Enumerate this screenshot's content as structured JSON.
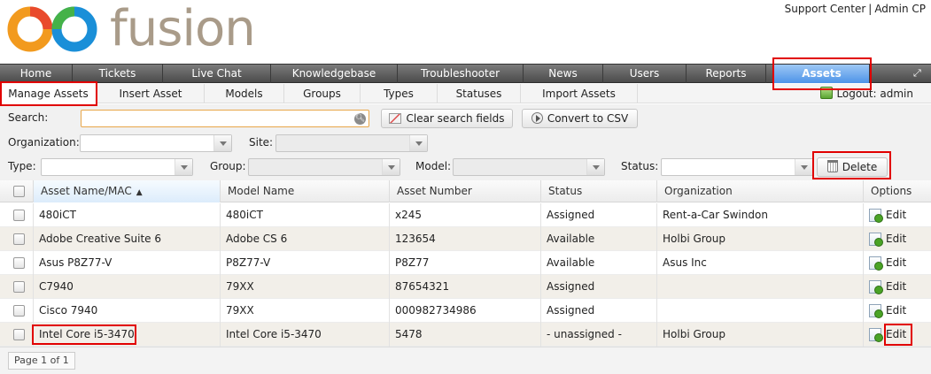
{
  "header": {
    "logo_text": "fusion",
    "support_link": "Support Center",
    "separator": "|",
    "admin_link": "Admin CP"
  },
  "main_nav": {
    "items": [
      {
        "label": "Home"
      },
      {
        "label": "Tickets"
      },
      {
        "label": "Live Chat"
      },
      {
        "label": "Knowledgebase"
      },
      {
        "label": "Troubleshooter"
      },
      {
        "label": "News"
      },
      {
        "label": "Users"
      },
      {
        "label": "Reports"
      },
      {
        "label": "Assets"
      }
    ],
    "active": "Assets"
  },
  "sub_nav": {
    "items": [
      {
        "label": "Manage Assets"
      },
      {
        "label": "Insert Asset"
      },
      {
        "label": "Models"
      },
      {
        "label": "Groups"
      },
      {
        "label": "Types"
      },
      {
        "label": "Statuses"
      },
      {
        "label": "Import Assets"
      }
    ],
    "active": "Manage Assets",
    "logout_label": "Logout: admin"
  },
  "filters": {
    "search_label": "Search:",
    "search_value": "",
    "clear_button": "Clear search fields",
    "csv_button": "Convert to CSV",
    "organization_label": "Organization:",
    "site_label": "Site:",
    "type_label": "Type:",
    "group_label": "Group:",
    "model_label": "Model:",
    "status_label": "Status:",
    "delete_button": "Delete"
  },
  "table": {
    "columns": [
      "Asset Name/MAC",
      "Model Name",
      "Asset Number",
      "Status",
      "Organization",
      "Options"
    ],
    "sort_column": "Asset Name/MAC",
    "rows": [
      {
        "name": "480iCT",
        "model": "480iCT",
        "number": "x245",
        "status": "Assigned",
        "org": "Rent-a-Car Swindon",
        "action": "Edit"
      },
      {
        "name": "Adobe Creative Suite 6",
        "model": "Adobe CS 6",
        "number": "123654",
        "status": "Available",
        "org": "Holbi Group",
        "action": "Edit"
      },
      {
        "name": "Asus P8Z77-V",
        "model": "P8Z77-V",
        "number": "P8Z77",
        "status": "Available",
        "org": "Asus Inc",
        "action": "Edit"
      },
      {
        "name": "C7940",
        "model": "79XX",
        "number": "87654321",
        "status": "Assigned",
        "org": "",
        "action": "Edit"
      },
      {
        "name": "Cisco 7940",
        "model": "79XX",
        "number": "000982734986",
        "status": "Assigned",
        "org": "",
        "action": "Edit"
      },
      {
        "name": "Intel Core i5-3470",
        "model": "Intel Core i5-3470",
        "number": "5478",
        "status": "- unassigned -",
        "org": "Holbi Group",
        "action": "Edit"
      }
    ]
  },
  "footer": {
    "pager": "Page 1 of 1"
  },
  "colors": {
    "nav_bg": "#5f5f5f",
    "active_tab": "#5a9ded",
    "highlight": "#e10000",
    "row_alt": "#f2efe9"
  }
}
